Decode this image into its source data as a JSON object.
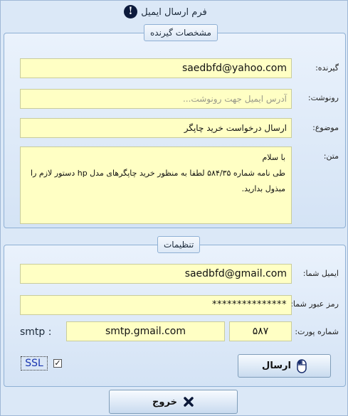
{
  "window": {
    "title": "فرم ارسال ایمیل"
  },
  "recipient_group": {
    "legend": "مشخصات گیرنده",
    "to_label": "گیرنده:",
    "to_value": "saedbfd@yahoo.com",
    "cc_label": "رونوشت:",
    "cc_placeholder": "آدرس ایمیل جهت رونوشت...",
    "subject_label": "موضوع:",
    "subject_value": "ارسال درخواست خرید چاپگر",
    "body_label": "متن:",
    "body_lines": [
      "با سلام",
      "طی نامه شماره ۵۸۴/۳۵ لطفا به منظور خرید چاپگرهای مدل hp دستور لازم را",
      "مبذول بدارید."
    ]
  },
  "settings_group": {
    "legend": "تنظیمات",
    "email_label": "ایمیل شما:",
    "email_value": "saedbfd@gmail.com",
    "password_label": "رمز عبور شما:",
    "password_value": "***************",
    "port_label": "شماره پورت:",
    "port_value": "۵۸۷",
    "smtp_label": "smtp :",
    "smtp_value": "smtp.gmail.com",
    "ssl_label": "SSL",
    "ssl_checked": true,
    "send_button": "ارسال"
  },
  "exit_button": "خروج",
  "icons": {
    "title_icon": "info-icon",
    "send_icon": "mouse-icon",
    "exit_icon": "close-icon"
  },
  "colors": {
    "field_background": "#ffffc4",
    "window_background": "#dbe8f7"
  }
}
